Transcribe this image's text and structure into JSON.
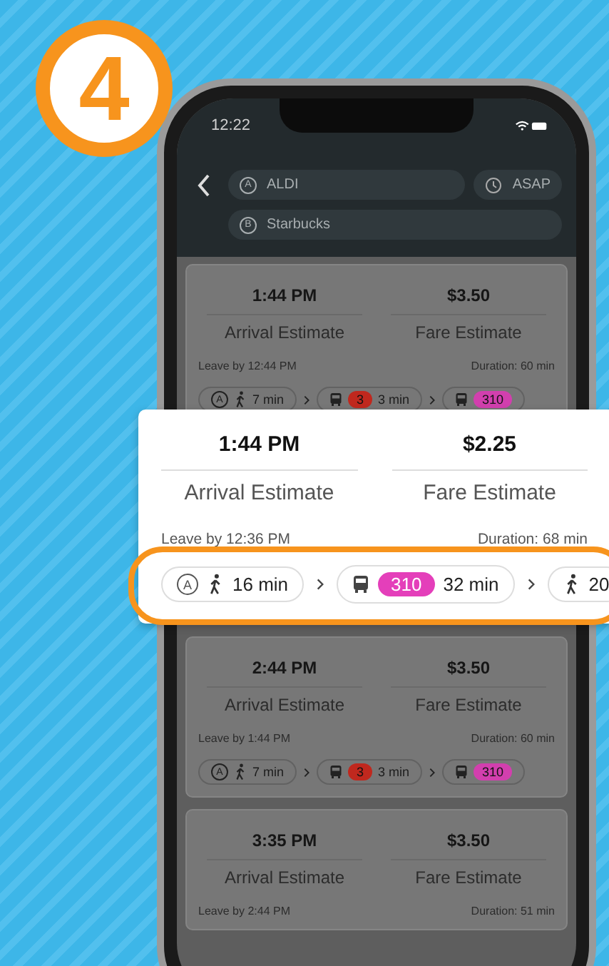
{
  "step_badge": "4",
  "status_bar": {
    "time": "12:22"
  },
  "search": {
    "origin_marker": "A",
    "origin": "ALDI",
    "time": "ASAP",
    "destination_marker": "B",
    "destination": "Starbucks"
  },
  "trips": [
    {
      "highlighted": false,
      "arrival": "1:44 PM",
      "arrival_label": "Arrival Estimate",
      "fare": "$3.50",
      "fare_label": "Fare Estimate",
      "leave": "Leave by 12:44 PM",
      "duration": "Duration: 60 min",
      "legs": [
        {
          "kind": "walk",
          "marker": "A",
          "text": "7 min"
        },
        {
          "kind": "bus",
          "route": "3",
          "color": "#c0281e",
          "text": "3 min"
        },
        {
          "kind": "bus",
          "route": "310",
          "color": "#d23fae"
        }
      ]
    },
    {
      "highlighted": true,
      "arrival": "1:44 PM",
      "arrival_label": "Arrival Estimate",
      "fare": "$2.25",
      "fare_label": "Fare Estimate",
      "leave": "Leave by 12:36 PM",
      "duration": "Duration: 68 min",
      "legs": [
        {
          "kind": "walk",
          "marker": "A",
          "text": "16 min"
        },
        {
          "kind": "bus",
          "route": "310",
          "color": "#e43fba",
          "text": "32 min"
        },
        {
          "kind": "walk",
          "text": "20"
        }
      ]
    },
    {
      "highlighted": false,
      "arrival": "2:44 PM",
      "arrival_label": "Arrival Estimate",
      "fare": "$3.50",
      "fare_label": "Fare Estimate",
      "leave": "Leave by 1:44 PM",
      "duration": "Duration: 60 min",
      "legs": [
        {
          "kind": "walk",
          "marker": "A",
          "text": "7 min"
        },
        {
          "kind": "bus",
          "route": "3",
          "color": "#c0281e",
          "text": "3 min"
        },
        {
          "kind": "bus",
          "route": "310",
          "color": "#d23fae"
        }
      ]
    },
    {
      "highlighted": false,
      "arrival": "3:35 PM",
      "arrival_label": "Arrival Estimate",
      "fare": "$3.50",
      "fare_label": "Fare Estimate",
      "leave": "Leave by 2:44 PM",
      "duration": "Duration: 51 min"
    }
  ]
}
